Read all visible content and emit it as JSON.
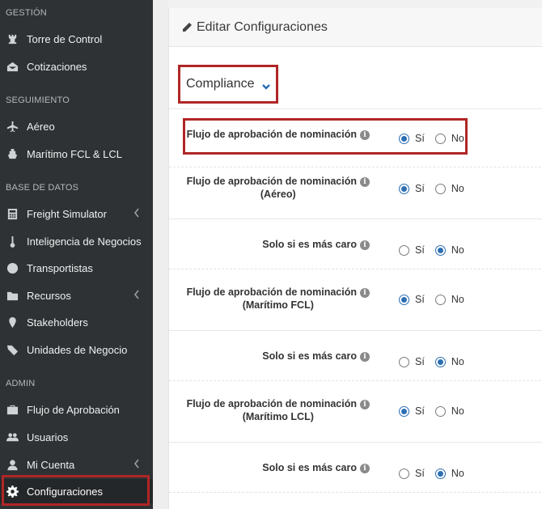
{
  "sidebar": {
    "sections": [
      {
        "title": "GESTIÓN",
        "items": [
          {
            "label": "Torre de Control",
            "icon": "chess-rook-icon"
          },
          {
            "label": "Cotizaciones",
            "icon": "envelope-open-icon"
          }
        ]
      },
      {
        "title": "SEGUIMIENTO",
        "items": [
          {
            "label": "Aéreo",
            "icon": "plane-icon"
          },
          {
            "label": "Marítimo FCL & LCL",
            "icon": "ship-icon"
          }
        ]
      },
      {
        "title": "BASE DE DATOS",
        "items": [
          {
            "label": "Freight Simulator",
            "icon": "calculator-icon"
          },
          {
            "label": "Inteligencia de Negocios",
            "icon": "thermometer-icon"
          },
          {
            "label": "Transportistas",
            "icon": "globe-icon"
          },
          {
            "label": "Recursos",
            "icon": "folder-icon"
          },
          {
            "label": "Stakeholders",
            "icon": "map-pin-icon"
          },
          {
            "label": "Unidades de Negocio",
            "icon": "tags-icon"
          }
        ]
      },
      {
        "title": "ADMIN",
        "items": [
          {
            "label": "Flujo de Aprobación",
            "icon": "briefcase-icon"
          },
          {
            "label": "Usuarios",
            "icon": "users-icon"
          },
          {
            "label": "Mi Cuenta",
            "icon": "user-icon"
          },
          {
            "label": "Configuraciones",
            "icon": "gear-icon"
          }
        ]
      }
    ]
  },
  "panel": {
    "title": "Editar Configuraciones",
    "dropdown_value": "Compliance"
  },
  "settings": [
    {
      "label": "Flujo de aprobación de nominación",
      "sub": "",
      "selected": "yes"
    },
    {
      "label": "Flujo de aprobación de nominación",
      "sub": "(Aéreo)",
      "selected": "yes"
    },
    {
      "label": "Solo si es más caro",
      "sub": "",
      "selected": "no"
    },
    {
      "label": "Flujo de aprobación de nominación",
      "sub": "(Marítimo FCL)",
      "selected": "yes"
    },
    {
      "label": "Solo si es más caro",
      "sub": "",
      "selected": "no"
    },
    {
      "label": "Flujo de aprobación de nominación",
      "sub": "(Marítimo LCL)",
      "selected": "yes"
    },
    {
      "label": "Solo si es más caro",
      "sub": "",
      "selected": "no"
    }
  ],
  "radio_labels": {
    "yes": "Sí",
    "no": "No"
  },
  "info_glyph": "i",
  "colors": {
    "sidebar_bg": "#2e3235",
    "accent": "#2c6fb3",
    "highlight": "#b02626"
  }
}
